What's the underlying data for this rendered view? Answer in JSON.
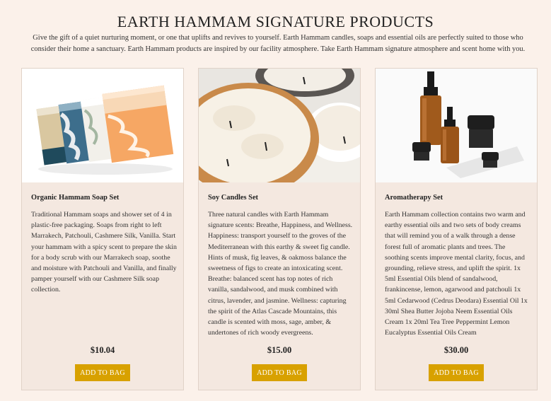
{
  "header": {
    "title": "EARTH HAMMAM SIGNATURE PRODUCTS",
    "intro": "Give the gift of a quiet nurturing moment, or one that uplifts and revives to yourself. Earth Hammam candles, soaps and essential oils are perfectly suited to those who consider their home a sanctuary. Earth Hammam products are inspired by our facility atmosphere. Take Earth Hammam signature atmosphere and scent home with you."
  },
  "colors": {
    "page_background": "#fbf1ea",
    "card_background": "#f4e8e0",
    "button": "#d8a100"
  },
  "products": [
    {
      "name": "Organic Hammam Soap Set",
      "description": "Traditional Hammam soaps and shower set of 4 in plastic-free packaging. Soaps from right to left Marrakech, Patchouli, Cashmere Silk, Vanilla. Start your hammam with a spicy scent to prepare the skin for a body scrub with our Marrakech soap, soothe and moisture with Patchouli and Vanilla, and finally pamper yourself with our Cashmere Silk soap collection.",
      "price": "$10.04",
      "button_label": "ADD TO BAG"
    },
    {
      "name": "Soy Candles Set",
      "description": "Three natural candles with Earth Hammam signature scents: Breathe, Happiness, and Wellness. Happiness: transport yourself to the groves of the Mediterranean with this earthy & sweet fig candle. Hints of musk, fig leaves, & oakmoss balance the sweetness of figs to create an intoxicating scent. Breathe: balanced scent has top notes of rich vanilla, sandalwood, and musk combined with citrus, lavender, and jasmine. Wellness: capturing the spirit of the Atlas Cascade Mountains, this candle is scented with moss, sage, amber, & undertones of rich woody evergreens.",
      "price": "$15.00",
      "button_label": "ADD TO BAG"
    },
    {
      "name": "Aromatherapy Set",
      "description": "Earth Hammam collection contains two warm and earthy essential oils and two sets of body creams that will remind you of a walk through a dense forest full of aromatic plants and trees. The soothing scents improve mental clarity, focus, and grounding, relieve stress, and uplift the spirit. 1x 5ml Essential Oils blend of sandalwood, frankincense, lemon, agarwood and patchouli 1x 5ml Cedarwood (Cedrus Deodara) Essential Oil 1x 30ml Shea Butter Jojoba Neem Essential Oils Cream 1x 20ml Tea Tree Peppermint Lemon Eucalyptus Essential Oils Cream",
      "price": "$30.00",
      "button_label": "ADD TO BAG"
    }
  ]
}
